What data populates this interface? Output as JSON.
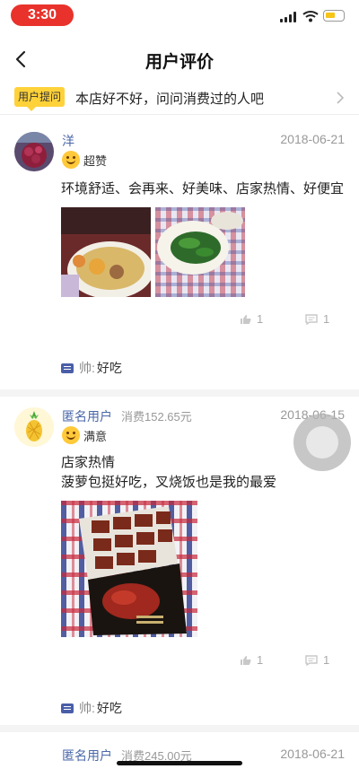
{
  "status_bar": {
    "time": "3:30"
  },
  "nav": {
    "title": "用户评价"
  },
  "question": {
    "badge": "用户提问",
    "text": "本店好不好，问问消费过的人吧"
  },
  "reviews": [
    {
      "user": "洋",
      "cost": "",
      "date": "2018-06-21",
      "rating_label": "超赞",
      "lines": [
        "环境舒适、会再来、好美味、店家热情、好便宜"
      ],
      "likes": "1",
      "comments": "1",
      "reply_name": "帅:",
      "reply_text": "好吃"
    },
    {
      "user": "匿名用户",
      "cost": "消费152.65元",
      "date": "2018-06-15",
      "rating_label": "满意",
      "lines": [
        "店家热情",
        "菠萝包挺好吃，叉烧饭也是我的最爱"
      ],
      "likes": "1",
      "comments": "1",
      "reply_name": "帅:",
      "reply_text": "好吃"
    },
    {
      "user": "匿名用户",
      "cost": "消费245.00元",
      "date": "2018-06-21"
    }
  ],
  "colors": {
    "accent": "#ffd23a",
    "username": "#4a67a8",
    "time_pill": "#e8322b"
  }
}
